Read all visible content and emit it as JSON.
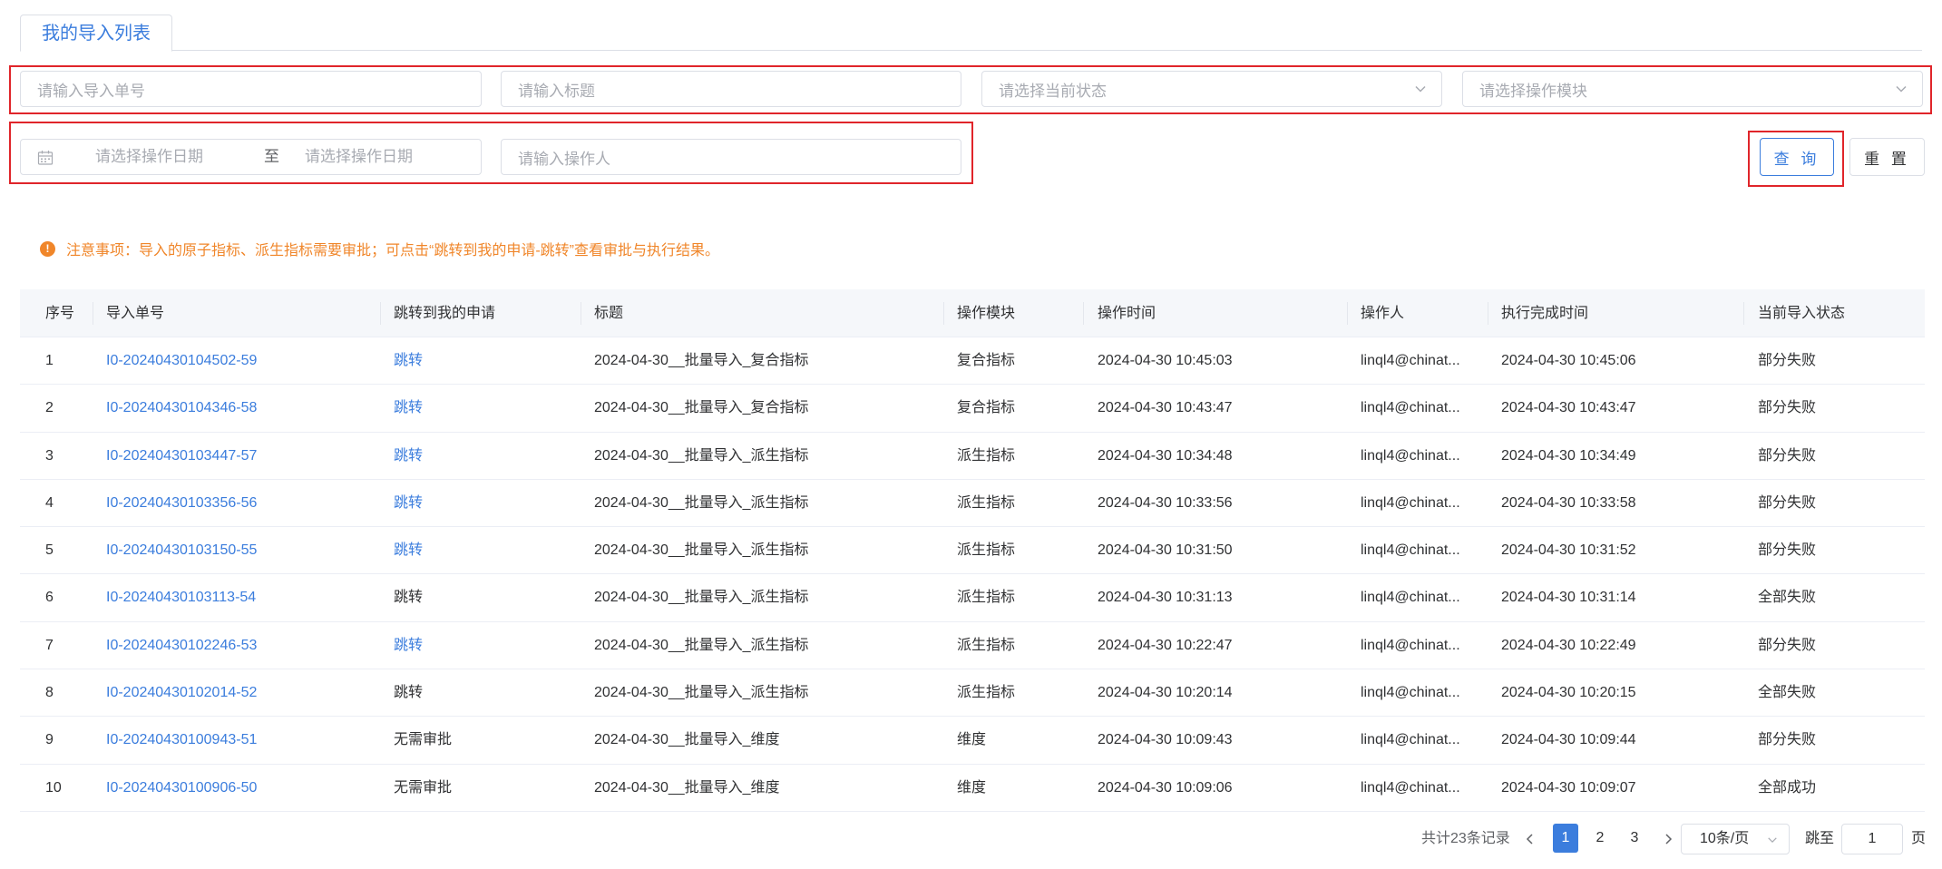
{
  "tabs": [
    {
      "label": "我的导入列表",
      "active": true
    }
  ],
  "filters": {
    "import_no_placeholder": "请输入导入单号",
    "title_placeholder": "请输入标题",
    "status_placeholder": "请选择当前状态",
    "module_placeholder": "请选择操作模块",
    "date_start_placeholder": "请选择操作日期",
    "date_separator": "至",
    "date_end_placeholder": "请选择操作日期",
    "operator_placeholder": "请输入操作人"
  },
  "buttons": {
    "query": "查 询",
    "reset": "重 置"
  },
  "notice": "注意事项：导入的原子指标、派生指标需要审批；可点击“跳转到我的申请-跳转”查看审批与执行结果。",
  "table": {
    "headers": [
      "序号",
      "导入单号",
      "跳转到我的申请",
      "标题",
      "操作模块",
      "操作时间",
      "操作人",
      "执行完成时间",
      "当前导入状态"
    ],
    "rows": [
      {
        "idx": "1",
        "no": "I0-20240430104502-59",
        "jump": "跳转",
        "jump_link": true,
        "title": "2024-04-30__批量导入_复合指标",
        "module": "复合指标",
        "op_time": "2024-04-30 10:45:03",
        "operator": "linql4@chinat...",
        "done_time": "2024-04-30 10:45:06",
        "status": "部分失败"
      },
      {
        "idx": "2",
        "no": "I0-20240430104346-58",
        "jump": "跳转",
        "jump_link": true,
        "title": "2024-04-30__批量导入_复合指标",
        "module": "复合指标",
        "op_time": "2024-04-30 10:43:47",
        "operator": "linql4@chinat...",
        "done_time": "2024-04-30 10:43:47",
        "status": "部分失败"
      },
      {
        "idx": "3",
        "no": "I0-20240430103447-57",
        "jump": "跳转",
        "jump_link": true,
        "title": "2024-04-30__批量导入_派生指标",
        "module": "派生指标",
        "op_time": "2024-04-30 10:34:48",
        "operator": "linql4@chinat...",
        "done_time": "2024-04-30 10:34:49",
        "status": "部分失败"
      },
      {
        "idx": "4",
        "no": "I0-20240430103356-56",
        "jump": "跳转",
        "jump_link": true,
        "title": "2024-04-30__批量导入_派生指标",
        "module": "派生指标",
        "op_time": "2024-04-30 10:33:56",
        "operator": "linql4@chinat...",
        "done_time": "2024-04-30 10:33:58",
        "status": "部分失败"
      },
      {
        "idx": "5",
        "no": "I0-20240430103150-55",
        "jump": "跳转",
        "jump_link": true,
        "title": "2024-04-30__批量导入_派生指标",
        "module": "派生指标",
        "op_time": "2024-04-30 10:31:50",
        "operator": "linql4@chinat...",
        "done_time": "2024-04-30 10:31:52",
        "status": "部分失败"
      },
      {
        "idx": "6",
        "no": "I0-20240430103113-54",
        "jump": "跳转",
        "jump_link": false,
        "title": "2024-04-30__批量导入_派生指标",
        "module": "派生指标",
        "op_time": "2024-04-30 10:31:13",
        "operator": "linql4@chinat...",
        "done_time": "2024-04-30 10:31:14",
        "status": "全部失败"
      },
      {
        "idx": "7",
        "no": "I0-20240430102246-53",
        "jump": "跳转",
        "jump_link": true,
        "title": "2024-04-30__批量导入_派生指标",
        "module": "派生指标",
        "op_time": "2024-04-30 10:22:47",
        "operator": "linql4@chinat...",
        "done_time": "2024-04-30 10:22:49",
        "status": "部分失败"
      },
      {
        "idx": "8",
        "no": "I0-20240430102014-52",
        "jump": "跳转",
        "jump_link": false,
        "title": "2024-04-30__批量导入_派生指标",
        "module": "派生指标",
        "op_time": "2024-04-30 10:20:14",
        "operator": "linql4@chinat...",
        "done_time": "2024-04-30 10:20:15",
        "status": "全部失败"
      },
      {
        "idx": "9",
        "no": "I0-20240430100943-51",
        "jump": "无需审批",
        "jump_link": false,
        "title": "2024-04-30__批量导入_维度",
        "module": "维度",
        "op_time": "2024-04-30 10:09:43",
        "operator": "linql4@chinat...",
        "done_time": "2024-04-30 10:09:44",
        "status": "部分失败"
      },
      {
        "idx": "10",
        "no": "I0-20240430100906-50",
        "jump": "无需审批",
        "jump_link": false,
        "title": "2024-04-30__批量导入_维度",
        "module": "维度",
        "op_time": "2024-04-30 10:09:06",
        "operator": "linql4@chinat...",
        "done_time": "2024-04-30 10:09:07",
        "status": "全部成功"
      }
    ]
  },
  "pagination": {
    "total_text": "共计23条记录",
    "pages": [
      "1",
      "2",
      "3"
    ],
    "current_page": "1",
    "page_size": "10条/页",
    "jump_label": "跳至",
    "jump_value": "1",
    "jump_suffix": "页"
  },
  "colors": {
    "primary": "#3b7ddd",
    "warning": "#f0862a",
    "highlight": "#e0252a"
  },
  "icons": [
    "calendar-icon",
    "chevron-down-icon",
    "warning-circle-icon",
    "chevron-left-icon",
    "chevron-right-icon"
  ]
}
